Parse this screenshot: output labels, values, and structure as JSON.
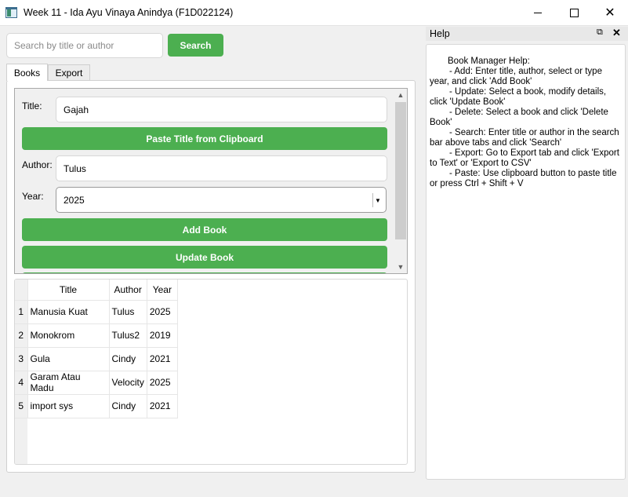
{
  "window": {
    "title": "Week 11 - Ida Ayu Vinaya Anindya (F1D022124)"
  },
  "search": {
    "placeholder": "Search by title or author",
    "value": "",
    "button_label": "Search"
  },
  "tabs": [
    {
      "label": "Books",
      "selected": true
    },
    {
      "label": "Export",
      "selected": false
    }
  ],
  "form": {
    "title_label": "Title:",
    "title_value": "Gajah",
    "paste_button_label": "Paste Title from Clipboard",
    "author_label": "Author:",
    "author_value": "Tulus",
    "year_label": "Year:",
    "year_value": "2025",
    "add_button_label": "Add Book",
    "update_button_label": "Update Book"
  },
  "table": {
    "columns": [
      "Title",
      "Author",
      "Year"
    ],
    "rows": [
      {
        "num": "1",
        "title": "Manusia Kuat",
        "author": "Tulus",
        "year": "2025"
      },
      {
        "num": "2",
        "title": "Monokrom",
        "author": "Tulus2",
        "year": "2019"
      },
      {
        "num": "3",
        "title": "Gula",
        "author": "Cindy",
        "year": "2021"
      },
      {
        "num": "4",
        "title": "Garam Atau Madu",
        "author": "Velocity",
        "year": "2025"
      },
      {
        "num": "5",
        "title": "import sys",
        "author": "Cindy",
        "year": "2021"
      }
    ]
  },
  "help": {
    "title": "Help",
    "lines": [
      "Book Manager Help:",
      "- Add: Enter title, author, select or type year, and click 'Add Book'",
      "- Update: Select a book, modify details, click 'Update Book'",
      "- Delete: Select a book and click 'Delete Book'",
      "- Search: Enter title or author in the search bar above tabs and click 'Search'",
      "- Export: Go to Export tab and click 'Export to Text' or 'Export to CSV'",
      "- Paste: Use clipboard button to paste title or press Ctrl + Shift + V"
    ]
  },
  "colors": {
    "accent_green": "#4caf50",
    "window_bg": "#f0f0f0"
  }
}
